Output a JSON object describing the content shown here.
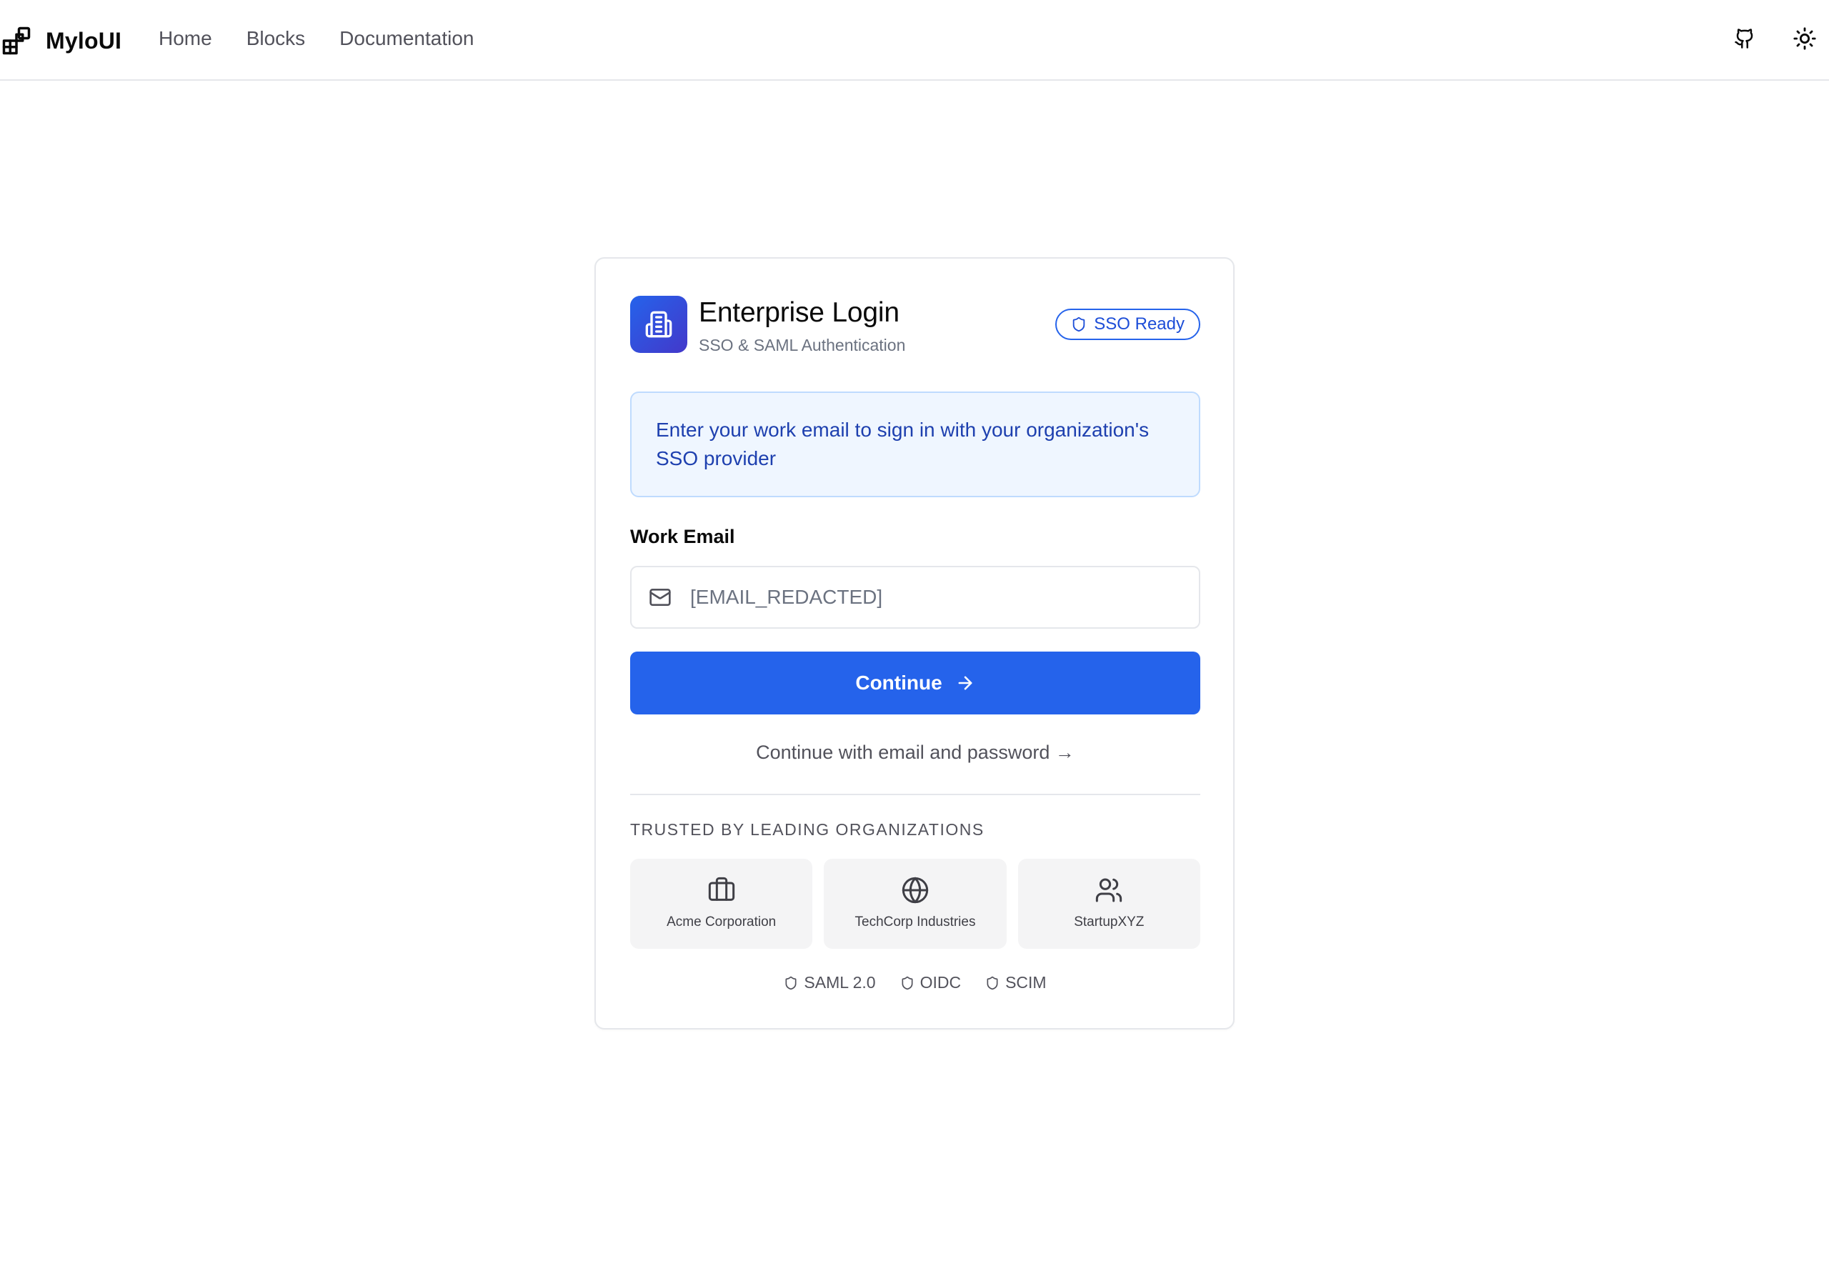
{
  "nav": {
    "brand": "MyloUI",
    "links": [
      "Home",
      "Blocks",
      "Documentation"
    ],
    "icons": {
      "logo": "blocks-logo-icon",
      "github": "github-icon",
      "theme": "sun-icon"
    }
  },
  "card": {
    "title": "Enterprise Login",
    "subtitle": "SSO & SAML Authentication",
    "badge": "SSO Ready",
    "info": "Enter your work email to sign in with your organization's SSO provider",
    "email_label": "Work Email",
    "email_placeholder": "[EMAIL_REDACTED]",
    "continue_label": "Continue",
    "alt_login": "Continue with email and password →",
    "trusted_heading": "TRUSTED BY LEADING ORGANIZATIONS",
    "organizations": [
      {
        "name": "Acme Corporation",
        "icon": "briefcase-icon"
      },
      {
        "name": "TechCorp Industries",
        "icon": "globe-icon"
      },
      {
        "name": "StartupXYZ",
        "icon": "users-icon"
      }
    ],
    "protocols": [
      "SAML 2.0",
      "OIDC",
      "SCIM"
    ]
  },
  "colors": {
    "primary": "#2563eb",
    "info_bg": "#eff6ff",
    "info_border": "#bfdbfe",
    "info_text": "#1e40af",
    "tile_bg": "#f4f4f5"
  }
}
